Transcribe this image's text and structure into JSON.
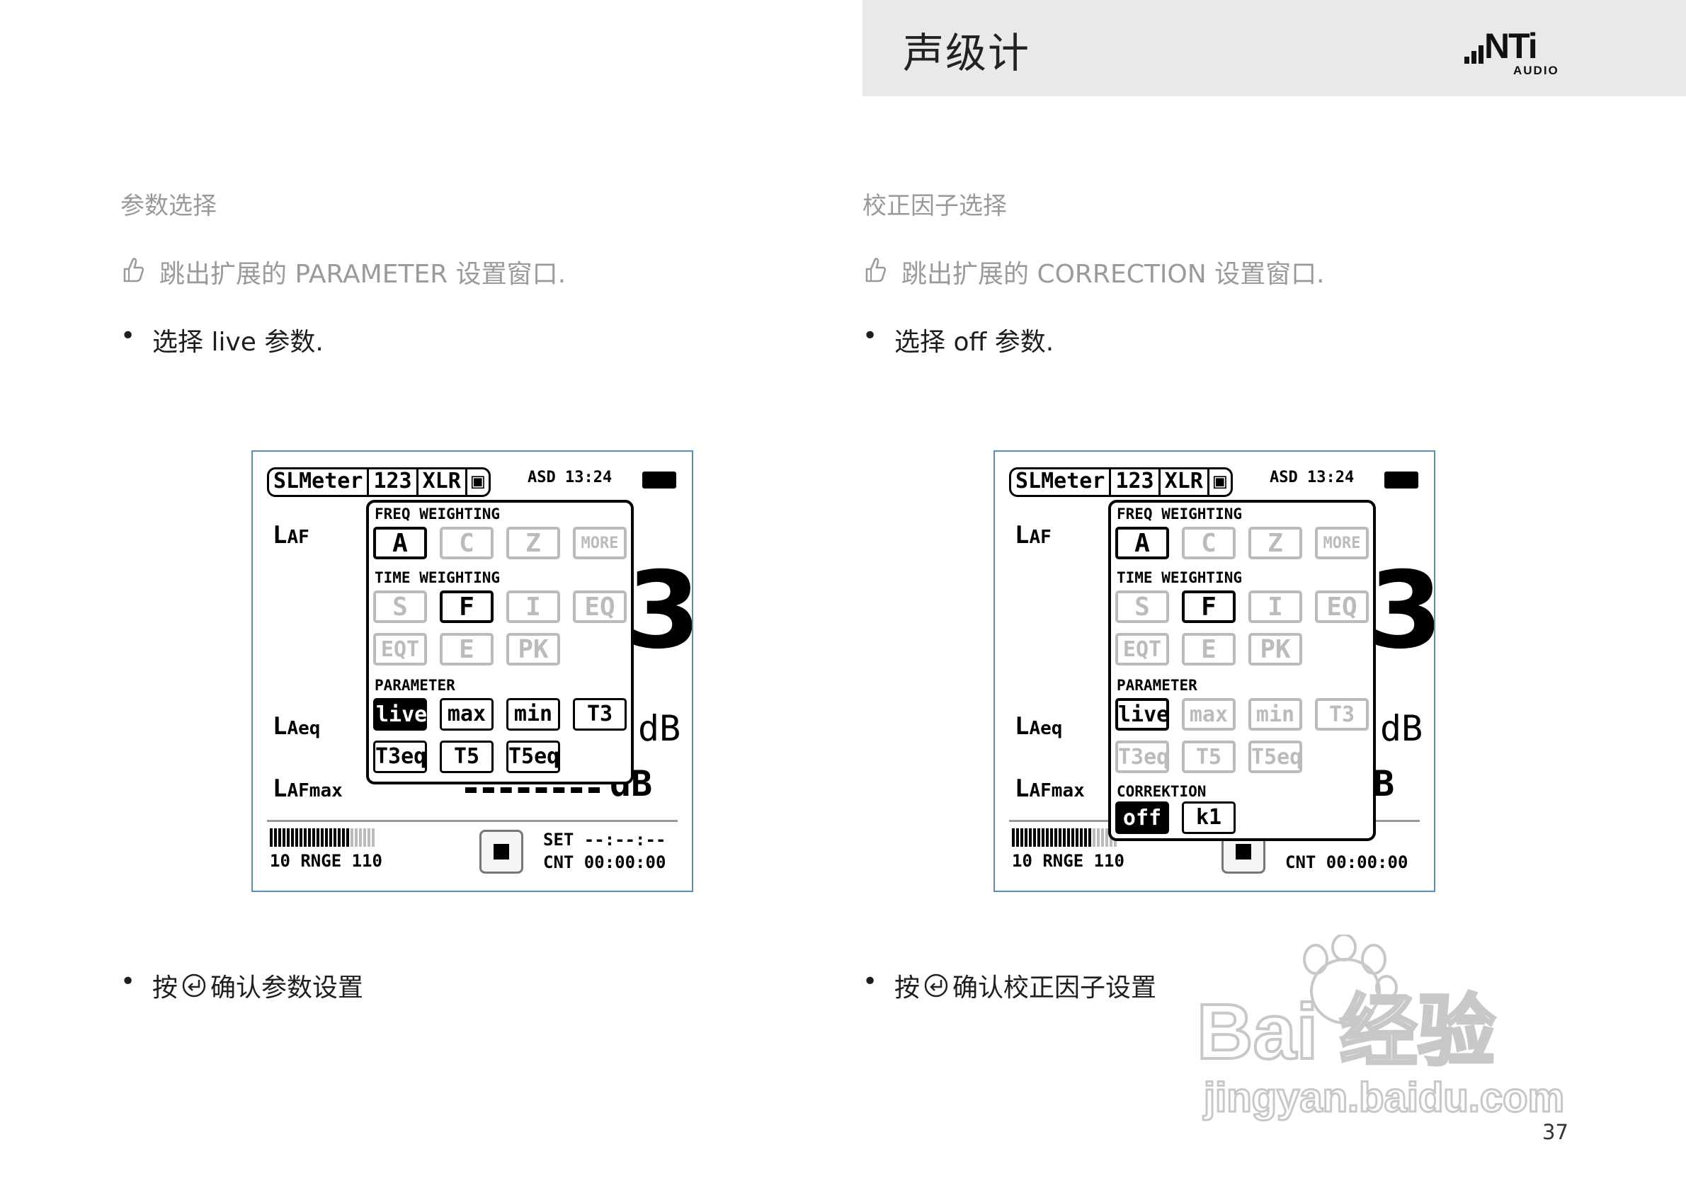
{
  "header": {
    "title": "声级计",
    "logo_main": "NTi",
    "logo_sub": "AUDIO"
  },
  "left": {
    "heading": "参数选择",
    "hint": "跳出扩展的 PARAMETER 设置窗口.",
    "bullet1": "选择 live 参数.",
    "bullet2_pre": "按",
    "bullet2_post": "确认参数设置"
  },
  "right": {
    "heading": "校正因子选择",
    "hint": "跳出扩展的 CORRECTION 设置窗口.",
    "bullet1": "选择 off 参数.",
    "bullet2_pre": "按",
    "bullet2_post": "确认校正因子设置"
  },
  "bullet_symbol": "•",
  "device": {
    "status_tabs": [
      "SLMeter",
      "123",
      "XLR",
      "▣"
    ],
    "status_right": "ASD 13:24",
    "laf": "L",
    "laf_sub": "AF",
    "laeq": "L",
    "laeq_sub": "Aeq",
    "lafmax": "L",
    "lafmax_sub": "AFmax",
    "db": "dB",
    "big_digit": "3",
    "range": "10  RNGE 110",
    "set": "SET --:--:--",
    "cnt": "CNT 00:00:00",
    "freq_label": "FREQ WEIGHTING",
    "time_label": "TIME WEIGHTING",
    "param_label": "PARAMETER",
    "corr_label": "CORREKTION",
    "freq_buttons": [
      "A",
      "C",
      "Z",
      "MORE"
    ],
    "time_buttons_row1": [
      "S",
      "F",
      "I",
      "EQ"
    ],
    "time_buttons_row2": [
      "EQT",
      "E",
      "PK"
    ],
    "param_buttons_row1": [
      "live",
      "max",
      "min",
      "T3"
    ],
    "param_buttons_row2": [
      "T3eq",
      "T5",
      "T5eq"
    ],
    "corr_buttons": [
      "off",
      "k1"
    ]
  },
  "page_number": "37",
  "watermark": {
    "brand": "Bai  经验",
    "url": "jingyan.baidu.com"
  }
}
